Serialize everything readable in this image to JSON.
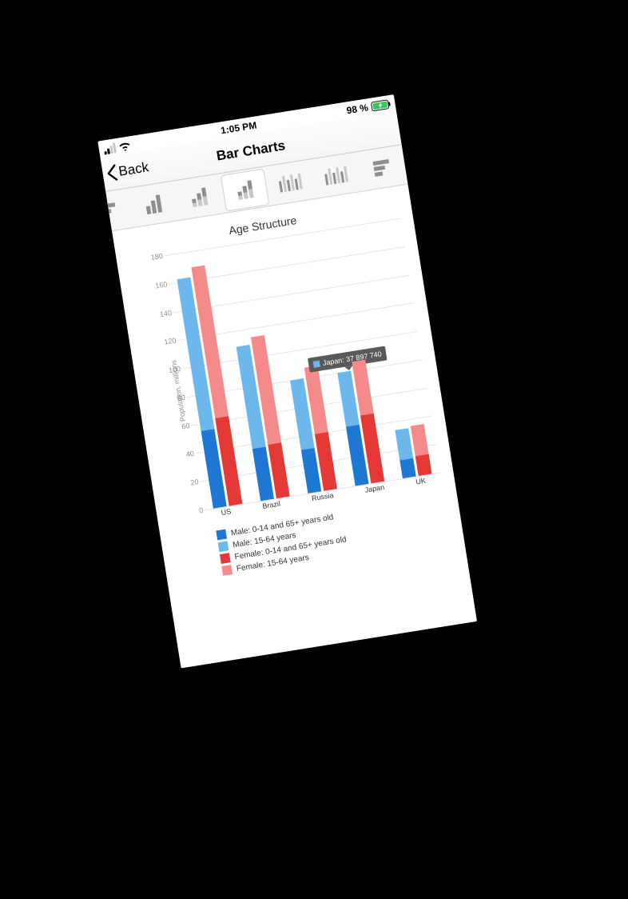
{
  "status": {
    "time": "1:05 PM",
    "battery_text": "98 %"
  },
  "nav": {
    "back": "Back",
    "title": "Bar Charts"
  },
  "toolbar": {
    "items": [
      {
        "name": "hbar-peek",
        "kind": "hor"
      },
      {
        "name": "bar-simple",
        "kind": "asc"
      },
      {
        "name": "bar-stacked-2",
        "kind": "asc-stacked"
      },
      {
        "name": "bar-stacked-3",
        "kind": "asc-stacked",
        "selected": true
      },
      {
        "name": "bar-grouped",
        "kind": "grouped"
      },
      {
        "name": "bar-grouped-alt",
        "kind": "grouped"
      },
      {
        "name": "hbar-right",
        "kind": "hor"
      }
    ]
  },
  "chart": {
    "title": "Age Structure",
    "ylabel": "Population, millions",
    "ylim": [
      0,
      180
    ],
    "ystep": 20,
    "colors": {
      "male_dep": "#1f77d4",
      "male_work": "#6cb7ec",
      "female_dep": "#e53935",
      "female_work": "#f48a8a"
    }
  },
  "legend": [
    {
      "key": "male_dep",
      "label": "Male: 0-14 and 65+ years old"
    },
    {
      "key": "male_work",
      "label": "Male: 15-64 years"
    },
    {
      "key": "female_dep",
      "label": "Female: 0-14 and 65+ years old"
    },
    {
      "key": "female_work",
      "label": "Female: 15-64 years"
    }
  ],
  "tooltip": {
    "color_key": "male_work",
    "text": "Japan: 37 897 740",
    "group_index": 3
  },
  "chart_data": {
    "type": "bar",
    "stacked": true,
    "title": "Age Structure",
    "ylabel": "Population, millions",
    "xlabel": "",
    "ylim": [
      0,
      180
    ],
    "categories": [
      "US",
      "Brazil",
      "Russia",
      "Japan",
      "UK"
    ],
    "series": [
      {
        "name": "Male: 0-14 and 65+ years old",
        "stack": "male",
        "values": [
          55,
          37,
          31,
          42,
          13
        ]
      },
      {
        "name": "Male: 15-64 years",
        "stack": "male",
        "values": [
          107,
          72,
          49,
          38,
          21
        ]
      },
      {
        "name": "Female: 0-14 and 65+ years old",
        "stack": "female",
        "values": [
          62,
          38,
          40,
          48,
          14
        ]
      },
      {
        "name": "Female: 15-64 years",
        "stack": "female",
        "values": [
          107,
          76,
          47,
          38,
          21
        ]
      }
    ],
    "highlight": {
      "category": "Japan",
      "series": "Male: 15-64 years",
      "value_label": "37 897 740"
    }
  }
}
